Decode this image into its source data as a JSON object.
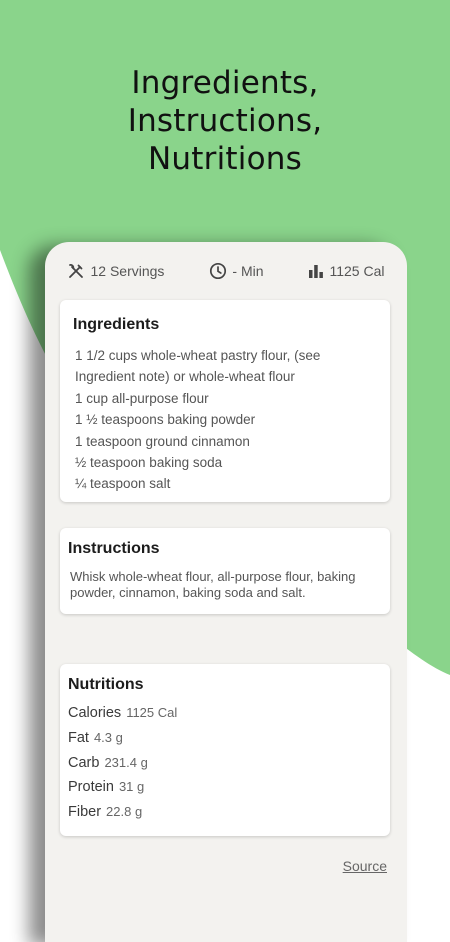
{
  "headline": {
    "line1": "Ingredients,",
    "line2": "Instructions,",
    "line3": "Nutritions"
  },
  "colors": {
    "green_bg": "#8ad48b",
    "card_surface": "#f3f2ef"
  },
  "stats": {
    "servings": {
      "icon": "utensils-icon",
      "label": "12 Servings"
    },
    "time": {
      "icon": "clock-icon",
      "label": "- Min"
    },
    "calories": {
      "icon": "bar-chart-icon",
      "label": "1125 Cal"
    }
  },
  "ingredients": {
    "title": "Ingredients",
    "items": [
      "1 1/2 cups whole-wheat pastry flour, (see",
      "Ingredient note) or whole-wheat flour",
      "1 cup all-purpose flour",
      "1 ½ teaspoons baking powder",
      "1 teaspoon ground cinnamon",
      "½ teaspoon baking soda",
      "¼ teaspoon salt"
    ]
  },
  "instructions": {
    "title": "Instructions",
    "text": "Whisk whole-wheat flour, all-purpose flour, baking powder, cinnamon, baking soda and salt."
  },
  "nutritions": {
    "title": "Nutritions",
    "items": [
      {
        "label": "Calories",
        "value": "1125 Cal"
      },
      {
        "label": "Fat",
        "value": "4.3 g"
      },
      {
        "label": "Carb",
        "value": "231.4 g"
      },
      {
        "label": "Protein",
        "value": "31 g"
      },
      {
        "label": "Fiber",
        "value": "22.8 g"
      }
    ]
  },
  "source_link": "Source"
}
